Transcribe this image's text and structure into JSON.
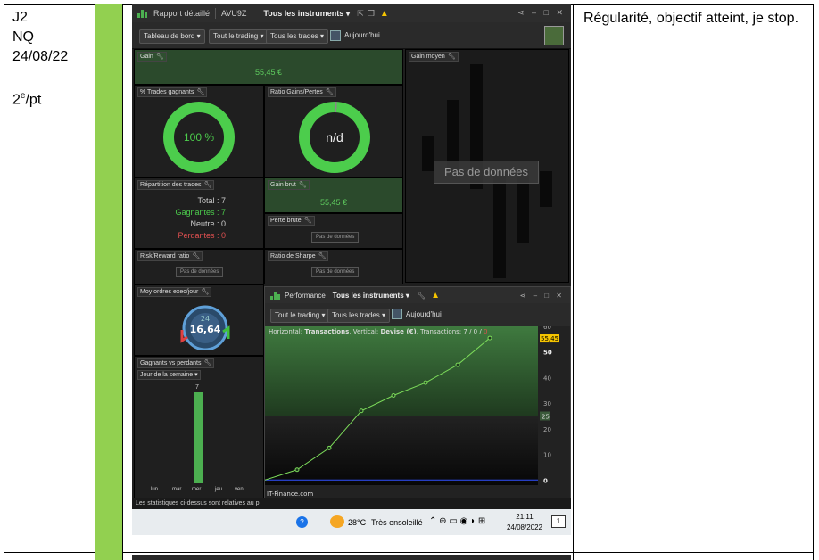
{
  "doc": {
    "col1": [
      "J2",
      "NQ",
      "24/08/22",
      "",
      "2e/pt"
    ],
    "col1_sup_line": {
      "base": "2",
      "sup": "e",
      "rest": "/pt"
    },
    "col4": "Régularité, objectif atteint, je stop."
  },
  "app": {
    "title": "Rapport détaillé",
    "account": "AVU9Z",
    "instruments": "Tous les instruments",
    "toolbar": {
      "dashboard": "Tableau de bord",
      "trading": "Tout le trading",
      "trades": "Tous les trades",
      "date": "Aujourd'hui"
    },
    "panels": {
      "gain": {
        "title": "Gain",
        "value": "55,45 €"
      },
      "avg_gain": {
        "title": "Gain moyen",
        "nodata": "Pas de données"
      },
      "win_pct": {
        "title": "% Trades gagnants",
        "value": "100 %"
      },
      "ratio": {
        "title": "Ratio Gains/Pertes",
        "value": "n/d"
      },
      "repartition": {
        "title": "Répartition des trades",
        "total": "Total : 7",
        "winners": "Gagnantes : 7",
        "neutral": "Neutre : 0",
        "losers": "Perdantes : 0"
      },
      "gross_gain": {
        "title": "Gain brut",
        "value": "55,45 €"
      },
      "gross_loss": {
        "title": "Perte brute",
        "nodata": "Pas de données"
      },
      "rr": {
        "title": "Risk/Reward ratio",
        "nodata": "Pas de données"
      },
      "sharpe": {
        "title": "Ratio de Sharpe",
        "nodata": "Pas de données"
      },
      "exec": {
        "title": "Moy ordres exec/jour",
        "value": "16,64",
        "small": "24"
      },
      "winloss": {
        "title": "Gagnants vs perdants",
        "dropdown": "Jour de la semaine",
        "bar_label": "7",
        "days": [
          "lun.",
          "mar.",
          "mer.",
          "jeu.",
          "ven."
        ],
        "values": [
          0,
          0,
          7,
          0,
          0
        ]
      }
    },
    "status": "Les statistiques ci-dessus sont relatives au p"
  },
  "perf": {
    "title": "Performance",
    "instruments": "Tous les instruments",
    "trading": "Tout le trading",
    "trades": "Tous les trades",
    "date": "Aujourd'hui",
    "info_prefix": "Horizontal: ",
    "info_h": "Transactions",
    "info_mid": ", Vertical: ",
    "info_v": "Devise (€)",
    "info_tx": ", Transactions: ",
    "tx_total": "7",
    "tx_win": "0",
    "tx_loss": "0",
    "watermark": "IT-Finance.com",
    "last_value_label": "55,45",
    "level_label": "25",
    "colors": {
      "line": "#7cdb5a",
      "area_top": "#3f7a3f",
      "area_bottom": "#0d0d0d",
      "accent": "#f5c400"
    }
  },
  "chart_data": {
    "type": "line",
    "x": [
      0,
      1,
      2,
      3,
      4,
      5,
      6,
      7
    ],
    "y": [
      0,
      4,
      12.5,
      27,
      33,
      38,
      45,
      55.45
    ],
    "xlabel": "Transactions",
    "ylabel": "Devise (€)",
    "xlim": [
      0,
      8.5
    ],
    "ylim": [
      -2,
      60
    ],
    "xticks": [
      "0",
      "2",
      "4",
      "6",
      "8"
    ],
    "yticks": [
      "0",
      "10",
      "20",
      "30",
      "40",
      "50",
      "60"
    ],
    "hline": 25
  },
  "taskbar": {
    "weather": "28°C",
    "weather_text": "Très ensoleillé",
    "time": "21:11",
    "date": "24/08/2022",
    "notif": "1"
  }
}
